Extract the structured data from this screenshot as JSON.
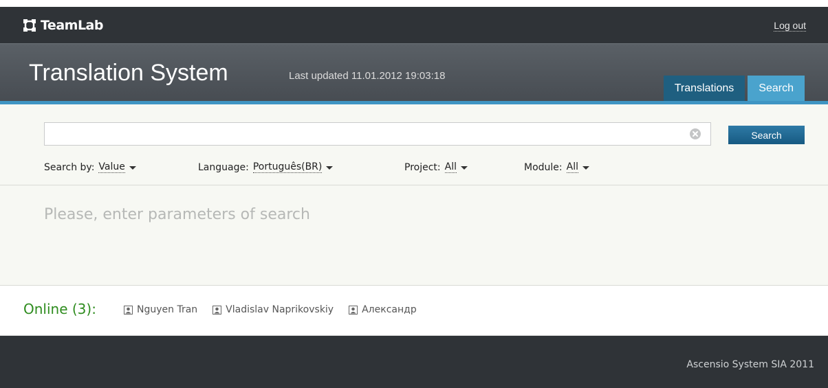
{
  "brand": {
    "name_prefix": "Team",
    "name_suffix": "Lab"
  },
  "topbar": {
    "logout_label": "Log out"
  },
  "header": {
    "title": "Translation System",
    "last_updated": "Last updated 11.01.2012 19:03:18",
    "tabs": [
      {
        "label": "Translations"
      },
      {
        "label": "Search"
      }
    ]
  },
  "search": {
    "value": "",
    "placeholder": "",
    "button_label": "Search",
    "filters": {
      "search_by": {
        "label": "Search by:",
        "value": "Value"
      },
      "language": {
        "label": "Language:",
        "value": "Português(BR)"
      },
      "project": {
        "label": "Project:",
        "value": "All"
      },
      "module": {
        "label": "Module:",
        "value": "All"
      }
    }
  },
  "content": {
    "empty_message": "Please, enter parameters of search"
  },
  "online": {
    "label": "Online (3):",
    "users": [
      {
        "name": "Nguyen Tran"
      },
      {
        "name": "Vladislav Naprikovskiy"
      },
      {
        "name": "Александр"
      }
    ]
  },
  "footer": {
    "copyright": "Ascensio System SIA 2011"
  },
  "colors": {
    "topbar_bg": "#2f3337",
    "active_tab": "#4aa3cd",
    "inactive_tab": "#1f5f80",
    "accent": "#3f95c3",
    "online_green": "#2e8c1e"
  }
}
